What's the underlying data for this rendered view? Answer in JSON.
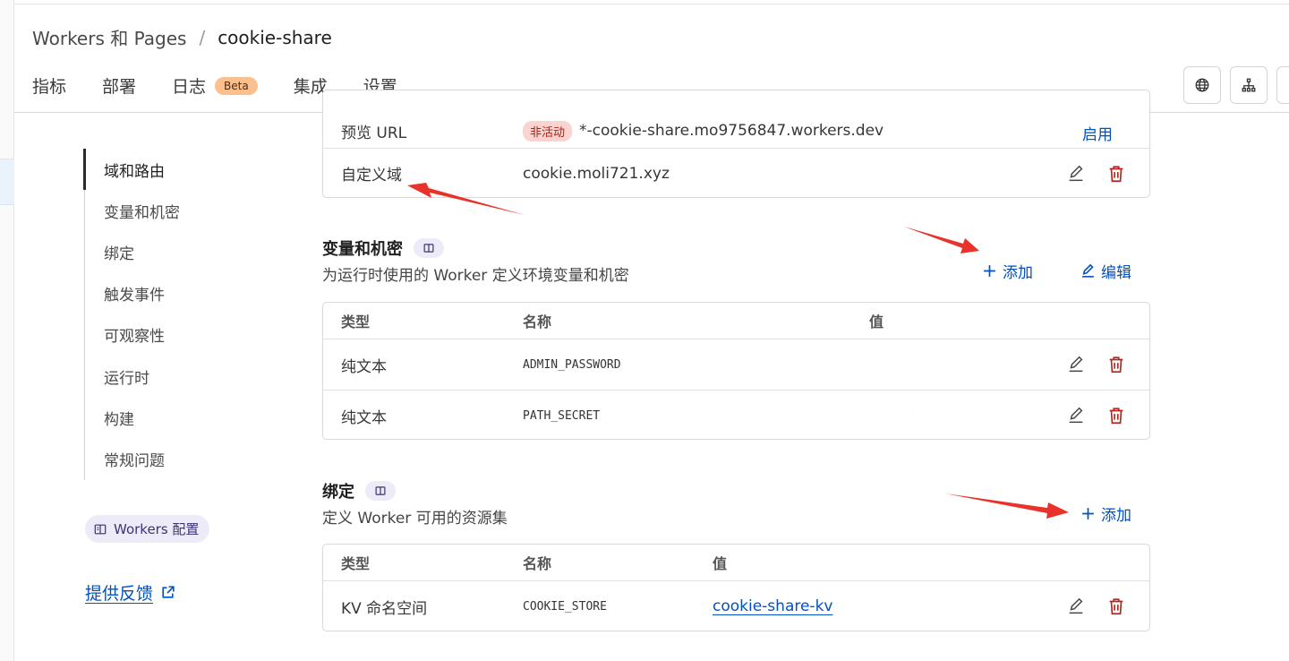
{
  "breadcrumb": {
    "parent": "Workers 和 Pages",
    "separator": "/",
    "current": "cookie-share"
  },
  "tabs": [
    {
      "label": "指标",
      "active": false
    },
    {
      "label": "部署",
      "active": false
    },
    {
      "label": "日志",
      "active": false,
      "badge": "Beta"
    },
    {
      "label": "集成",
      "active": false
    },
    {
      "label": "设置",
      "active": true
    }
  ],
  "toolbar": {
    "icons": [
      "globe-icon",
      "sitemap-icon"
    ]
  },
  "sidebar": {
    "items": [
      {
        "label": "域和路由",
        "active": true
      },
      {
        "label": "变量和机密",
        "active": false
      },
      {
        "label": "绑定",
        "active": false
      },
      {
        "label": "触发事件",
        "active": false
      },
      {
        "label": "可观察性",
        "active": false
      },
      {
        "label": "运行时",
        "active": false
      },
      {
        "label": "构建",
        "active": false
      },
      {
        "label": "常规问题",
        "active": false
      }
    ],
    "docs_pill": "Workers 配置",
    "feedback": "提供反馈"
  },
  "domains": {
    "rows": [
      {
        "type": "预览 URL",
        "status": "非活动",
        "value": "*-cookie-share.mo9756847.workers.dev",
        "action": "启用"
      },
      {
        "type": "自定义域",
        "value": "cookie.moli721.xyz"
      }
    ]
  },
  "variables": {
    "title": "变量和机密",
    "description": "为运行时使用的 Worker 定义环境变量和机密",
    "add_label": "添加",
    "edit_label": "编辑",
    "columns": [
      "类型",
      "名称",
      "值"
    ],
    "rows": [
      {
        "type": "纯文本",
        "name": "ADMIN_PASSWORD"
      },
      {
        "type": "纯文本",
        "name": "PATH_SECRET"
      }
    ]
  },
  "bindings": {
    "title": "绑定",
    "description": "定义 Worker 可用的资源集",
    "add_label": "添加",
    "columns": [
      "类型",
      "名称",
      "值"
    ],
    "rows": [
      {
        "type": "KV 命名空间",
        "name": "COOKIE_STORE",
        "value": "cookie-share-kv"
      }
    ]
  },
  "colors": {
    "accent": "#0051c3",
    "danger": "#b3261e",
    "annotation": "#e8322a",
    "beta": "#fbc08d"
  }
}
